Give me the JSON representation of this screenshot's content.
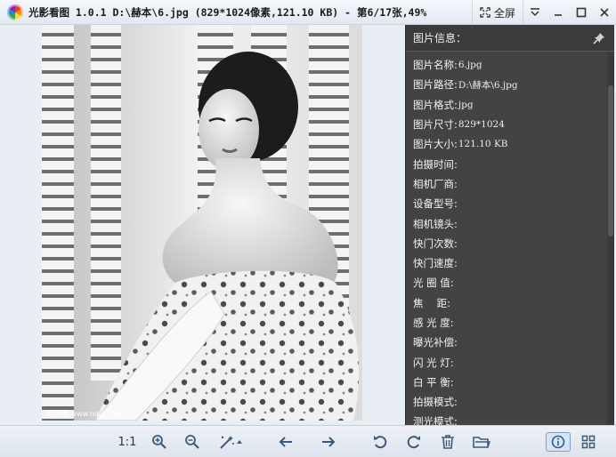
{
  "window": {
    "title": "光影看图 1.0.1 D:\\赫本\\6.jpg (829*1024像素,121.10 KB) - 第6/17张,49%",
    "fullscreen_label": "全屏"
  },
  "info_panel": {
    "header": "图片信息：",
    "rows": [
      {
        "key": "图片名称:",
        "value": "6.jpg"
      },
      {
        "key": "图片路径:",
        "value": "D:\\赫本\\6.jpg"
      },
      {
        "key": "图片格式:",
        "value": "jpg"
      },
      {
        "key": "图片尺寸:",
        "value": "829*1024"
      },
      {
        "key": "图片大小:",
        "value": "121.10 KB"
      },
      {
        "key": "拍摄时间:",
        "value": ""
      },
      {
        "key": "相机厂商:",
        "value": ""
      },
      {
        "key": "设备型号:",
        "value": ""
      },
      {
        "key": "相机镜头:",
        "value": ""
      },
      {
        "key": "快门次数:",
        "value": ""
      },
      {
        "key": "快门速度:",
        "value": ""
      },
      {
        "key": "光 圈 值:",
        "value": ""
      },
      {
        "key": "焦　 距:",
        "value": ""
      },
      {
        "key": "感 光 度:",
        "value": ""
      },
      {
        "key": "曝光补偿:",
        "value": ""
      },
      {
        "key": "闪 光 灯:",
        "value": ""
      },
      {
        "key": "白 平 衡:",
        "value": ""
      },
      {
        "key": "拍摄模式:",
        "value": ""
      },
      {
        "key": "测光模式:",
        "value": ""
      }
    ]
  },
  "toolbar": {
    "ratio_label": "1:1"
  },
  "photo": {
    "watermark": "昵图网 www.nipic.com"
  }
}
